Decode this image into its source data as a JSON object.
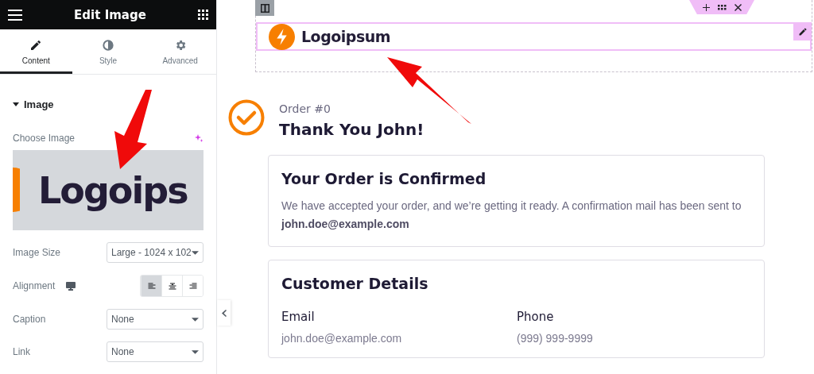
{
  "header": {
    "title": "Edit Image"
  },
  "tabs": [
    {
      "label": "Content",
      "selected": true
    },
    {
      "label": "Style",
      "selected": false
    },
    {
      "label": "Advanced",
      "selected": false
    }
  ],
  "section": {
    "title": "Image",
    "expanded": true
  },
  "choose_image": {
    "label": "Choose Image",
    "preview_text": "Logoips"
  },
  "controls": [
    {
      "kind": "select",
      "label": "Image Size",
      "value": "Large - 1024 x 102"
    },
    {
      "kind": "align",
      "label": "Alignment",
      "options": [
        {
          "selected": true
        },
        {
          "selected": false
        },
        {
          "selected": false
        }
      ]
    },
    {
      "kind": "select",
      "label": "Caption",
      "value": "None"
    },
    {
      "kind": "select",
      "label": "Link",
      "value": "None"
    }
  ],
  "canvas": {
    "logo_text": "Logoipsum",
    "order_number": "Order #0",
    "title": "Thank You John!",
    "cards": [
      {
        "kind": "text",
        "title": "Your Order is Confirmed",
        "text": "We have accepted your order, and we’re getting it ready. A confirmation mail has been sent to **john.doe@example.com**"
      },
      {
        "kind": "fields",
        "title": "Customer Details",
        "fields": [
          {
            "label": "Email",
            "value": "john.doe@example.com"
          },
          {
            "label": "Phone",
            "value": "(999) 999-9999"
          }
        ]
      }
    ]
  }
}
